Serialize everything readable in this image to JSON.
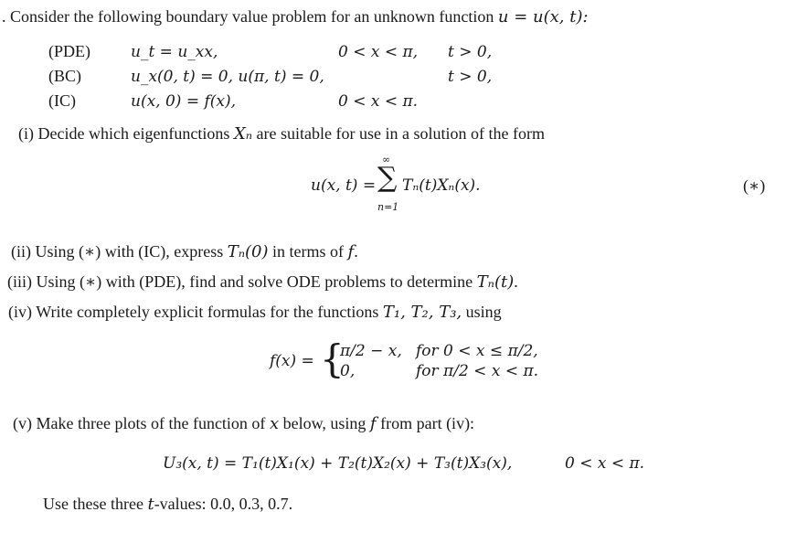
{
  "intro": {
    "prefix": ".",
    "text": "Consider the following boundary value problem for an unknown function",
    "math": "u = u(x, t):"
  },
  "system": [
    {
      "label": "(PDE)",
      "equation": "u_t = u_xx,",
      "domain_x": "0 < x < π,",
      "domain_t": "t > 0,"
    },
    {
      "label": "(BC)",
      "equation": "u_x(0, t) = 0, u(π, t) = 0,",
      "domain_x": "",
      "domain_t": "t > 0,"
    },
    {
      "label": "(IC)",
      "equation": "u(x, 0) = f(x),",
      "domain_x": "0 < x < π.",
      "domain_t": ""
    }
  ],
  "parts": {
    "i": {
      "label": "(i)",
      "text_before": "Decide which eigenfunctions",
      "math": "Xₙ",
      "text_after": "are suitable for use in a solution of the form"
    },
    "series": {
      "lhs": "u(x, t) =",
      "sum_top": "∞",
      "sum_symbol": "∑",
      "sum_bottom": "n=1",
      "term": "Tₙ(t)Xₙ(x).",
      "tag": "(∗)"
    },
    "ii": {
      "label": "(ii)",
      "text_before": "Using (∗) with (IC), express",
      "math": "Tₙ(0)",
      "text_after": "in terms of",
      "math2": "f",
      "end": "."
    },
    "iii": {
      "label": "(iii)",
      "text_before": "Using (∗) with (PDE), find and solve ODE problems to determine",
      "math": "Tₙ(t)",
      "end": "."
    },
    "iv": {
      "label": "(iv)",
      "text_before": "Write completely explicit formulas for the functions",
      "math": "T₁, T₂, T₃,",
      "text_after": "using"
    },
    "piecewise": {
      "lhs": "f(x) =",
      "cases": [
        {
          "value": "π/2 − x,",
          "condition": "for 0 < x ≤ π/2,"
        },
        {
          "value": "0,",
          "condition": "for π/2 < x < π."
        }
      ]
    },
    "v": {
      "label": "(v)",
      "text_before": "Make three plots of the function of",
      "math": "x",
      "text_after": "below, using",
      "math2": "f",
      "text_end": "from part (iv):"
    },
    "u3": {
      "equation": "U₃(x, t) = T₁(t)X₁(x) + T₂(t)X₂(x) + T₃(t)X₃(x),",
      "domain": "0 < x < π."
    },
    "tvalues": {
      "text_before": "Use these three",
      "math": "t",
      "text_after": "-values: 0.0, 0.3, 0.7."
    }
  }
}
